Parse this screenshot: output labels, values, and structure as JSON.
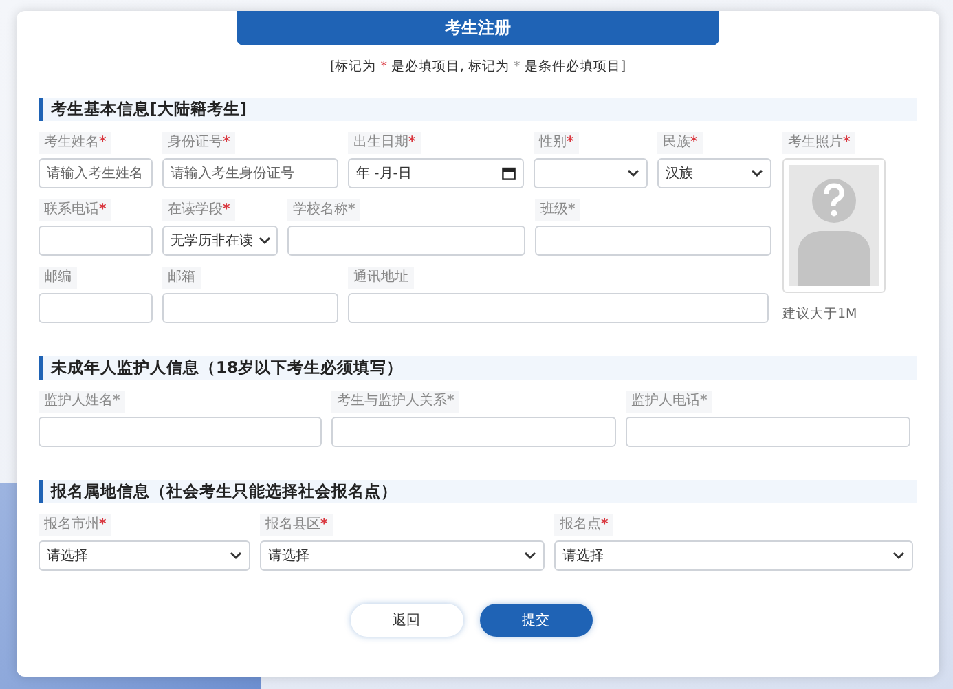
{
  "title": "考生注册",
  "notice": [
    {
      "text": "[标记为 ",
      "kind": "plain"
    },
    {
      "text": "*",
      "kind": "required"
    },
    {
      "text": " 是必填项目, 标记为 ",
      "kind": "plain"
    },
    {
      "text": "*",
      "kind": "conditional"
    },
    {
      "text": " 是条件必填项目]",
      "kind": "plain"
    }
  ],
  "sections": [
    {
      "title": "考生基本信息[大陆籍考生]",
      "rows": [
        [
          {
            "label": "考生姓名",
            "mark": "*",
            "required": true,
            "kind": "input",
            "placeholder": "请输入考生姓名"
          },
          {
            "label": "身份证号",
            "mark": "*",
            "required": true,
            "kind": "input",
            "placeholder": "请输入考生身份证号"
          },
          {
            "label": "出生日期",
            "mark": "*",
            "required": true,
            "kind": "date",
            "value": "年 -月-日"
          },
          {
            "label": "性别",
            "mark": "*",
            "required": true,
            "kind": "select"
          },
          {
            "label": "民族",
            "mark": "*",
            "required": true,
            "kind": "select",
            "value": "汉族"
          }
        ],
        [
          {
            "label": "联系电话",
            "mark": "*",
            "required": true,
            "kind": "input"
          },
          {
            "label": "在读学段",
            "mark": "*",
            "required": true,
            "kind": "select",
            "value": "无学历非在读"
          },
          {
            "label": "学校名称",
            "mark": "*",
            "required": false,
            "kind": "input"
          },
          {
            "label": "班级",
            "mark": "*",
            "required": false,
            "kind": "input"
          }
        ],
        [
          {
            "label": "邮编",
            "kind": "input"
          },
          {
            "label": "邮箱",
            "kind": "input"
          },
          {
            "label": "通讯地址",
            "kind": "input"
          }
        ]
      ],
      "photo": {
        "label": "考生照片",
        "mark": "*",
        "required": true,
        "hint": "建议大于1M"
      }
    },
    {
      "title": "未成年人监护人信息（18岁以下考生必须填写）",
      "rows": [
        [
          {
            "label": "监护人姓名",
            "mark": "*",
            "required": false,
            "kind": "input"
          },
          {
            "label": "考生与监护人关系",
            "mark": "*",
            "required": false,
            "kind": "input"
          },
          {
            "label": "监护人电话",
            "mark": "*",
            "required": false,
            "kind": "input"
          }
        ]
      ]
    },
    {
      "title": "报名属地信息（社会考生只能选择社会报名点）",
      "rows": [
        [
          {
            "label": "报名市州",
            "mark": "*",
            "required": true,
            "kind": "select",
            "value": "请选择"
          },
          {
            "label": "报名县区",
            "mark": "*",
            "required": true,
            "kind": "select",
            "value": "请选择"
          },
          {
            "label": "报名点",
            "mark": "*",
            "required": true,
            "kind": "select",
            "value": "请选择"
          }
        ]
      ]
    }
  ],
  "buttons": [
    {
      "label": "返回",
      "kind": "secondary"
    },
    {
      "label": "提交",
      "kind": "primary"
    }
  ]
}
